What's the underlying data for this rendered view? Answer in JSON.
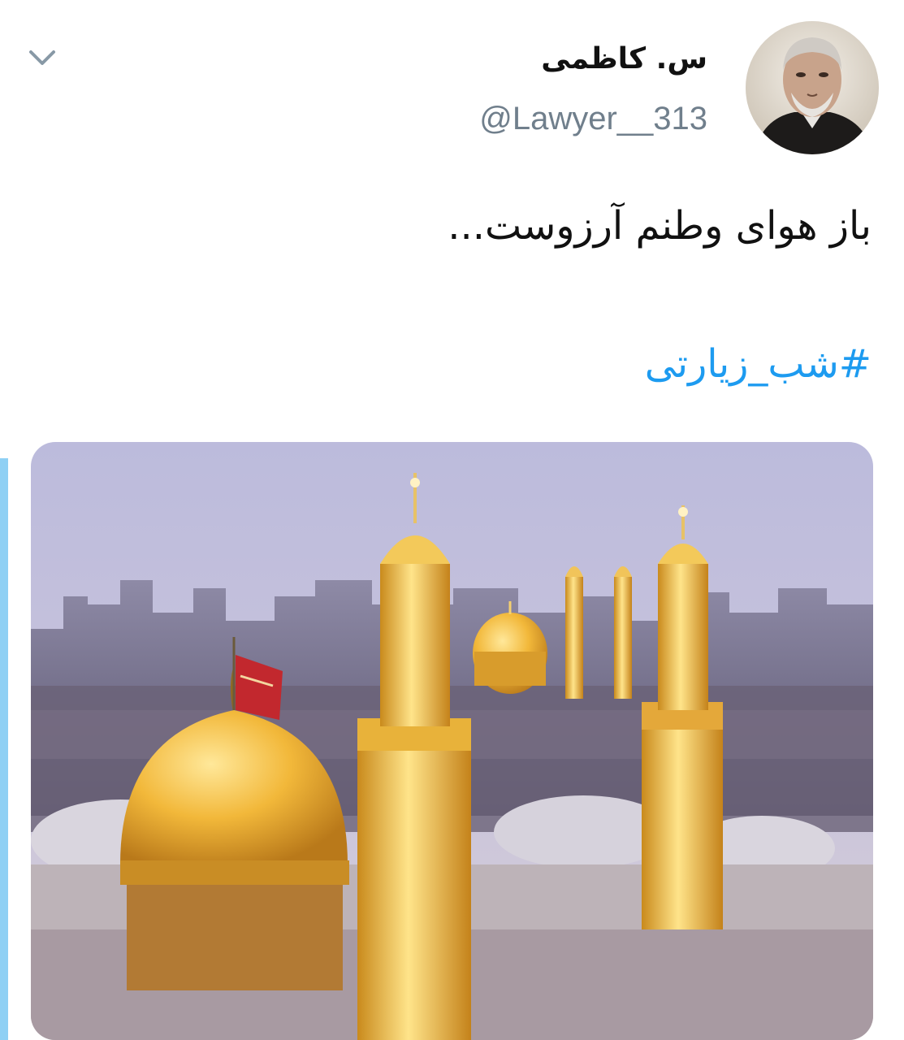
{
  "tweet": {
    "author": {
      "display_name": "س. کاظمی",
      "handle": "@Lawyer__313"
    },
    "text": "باز هوای وطنم آرزوست...",
    "hashtag": "#شب_زیارتی"
  },
  "icons": {
    "menu": "chevron-down-icon"
  },
  "colors": {
    "hashtag": "#1d9bf0",
    "handle": "#707f8c",
    "thread_bar": "#8fd0f4"
  }
}
